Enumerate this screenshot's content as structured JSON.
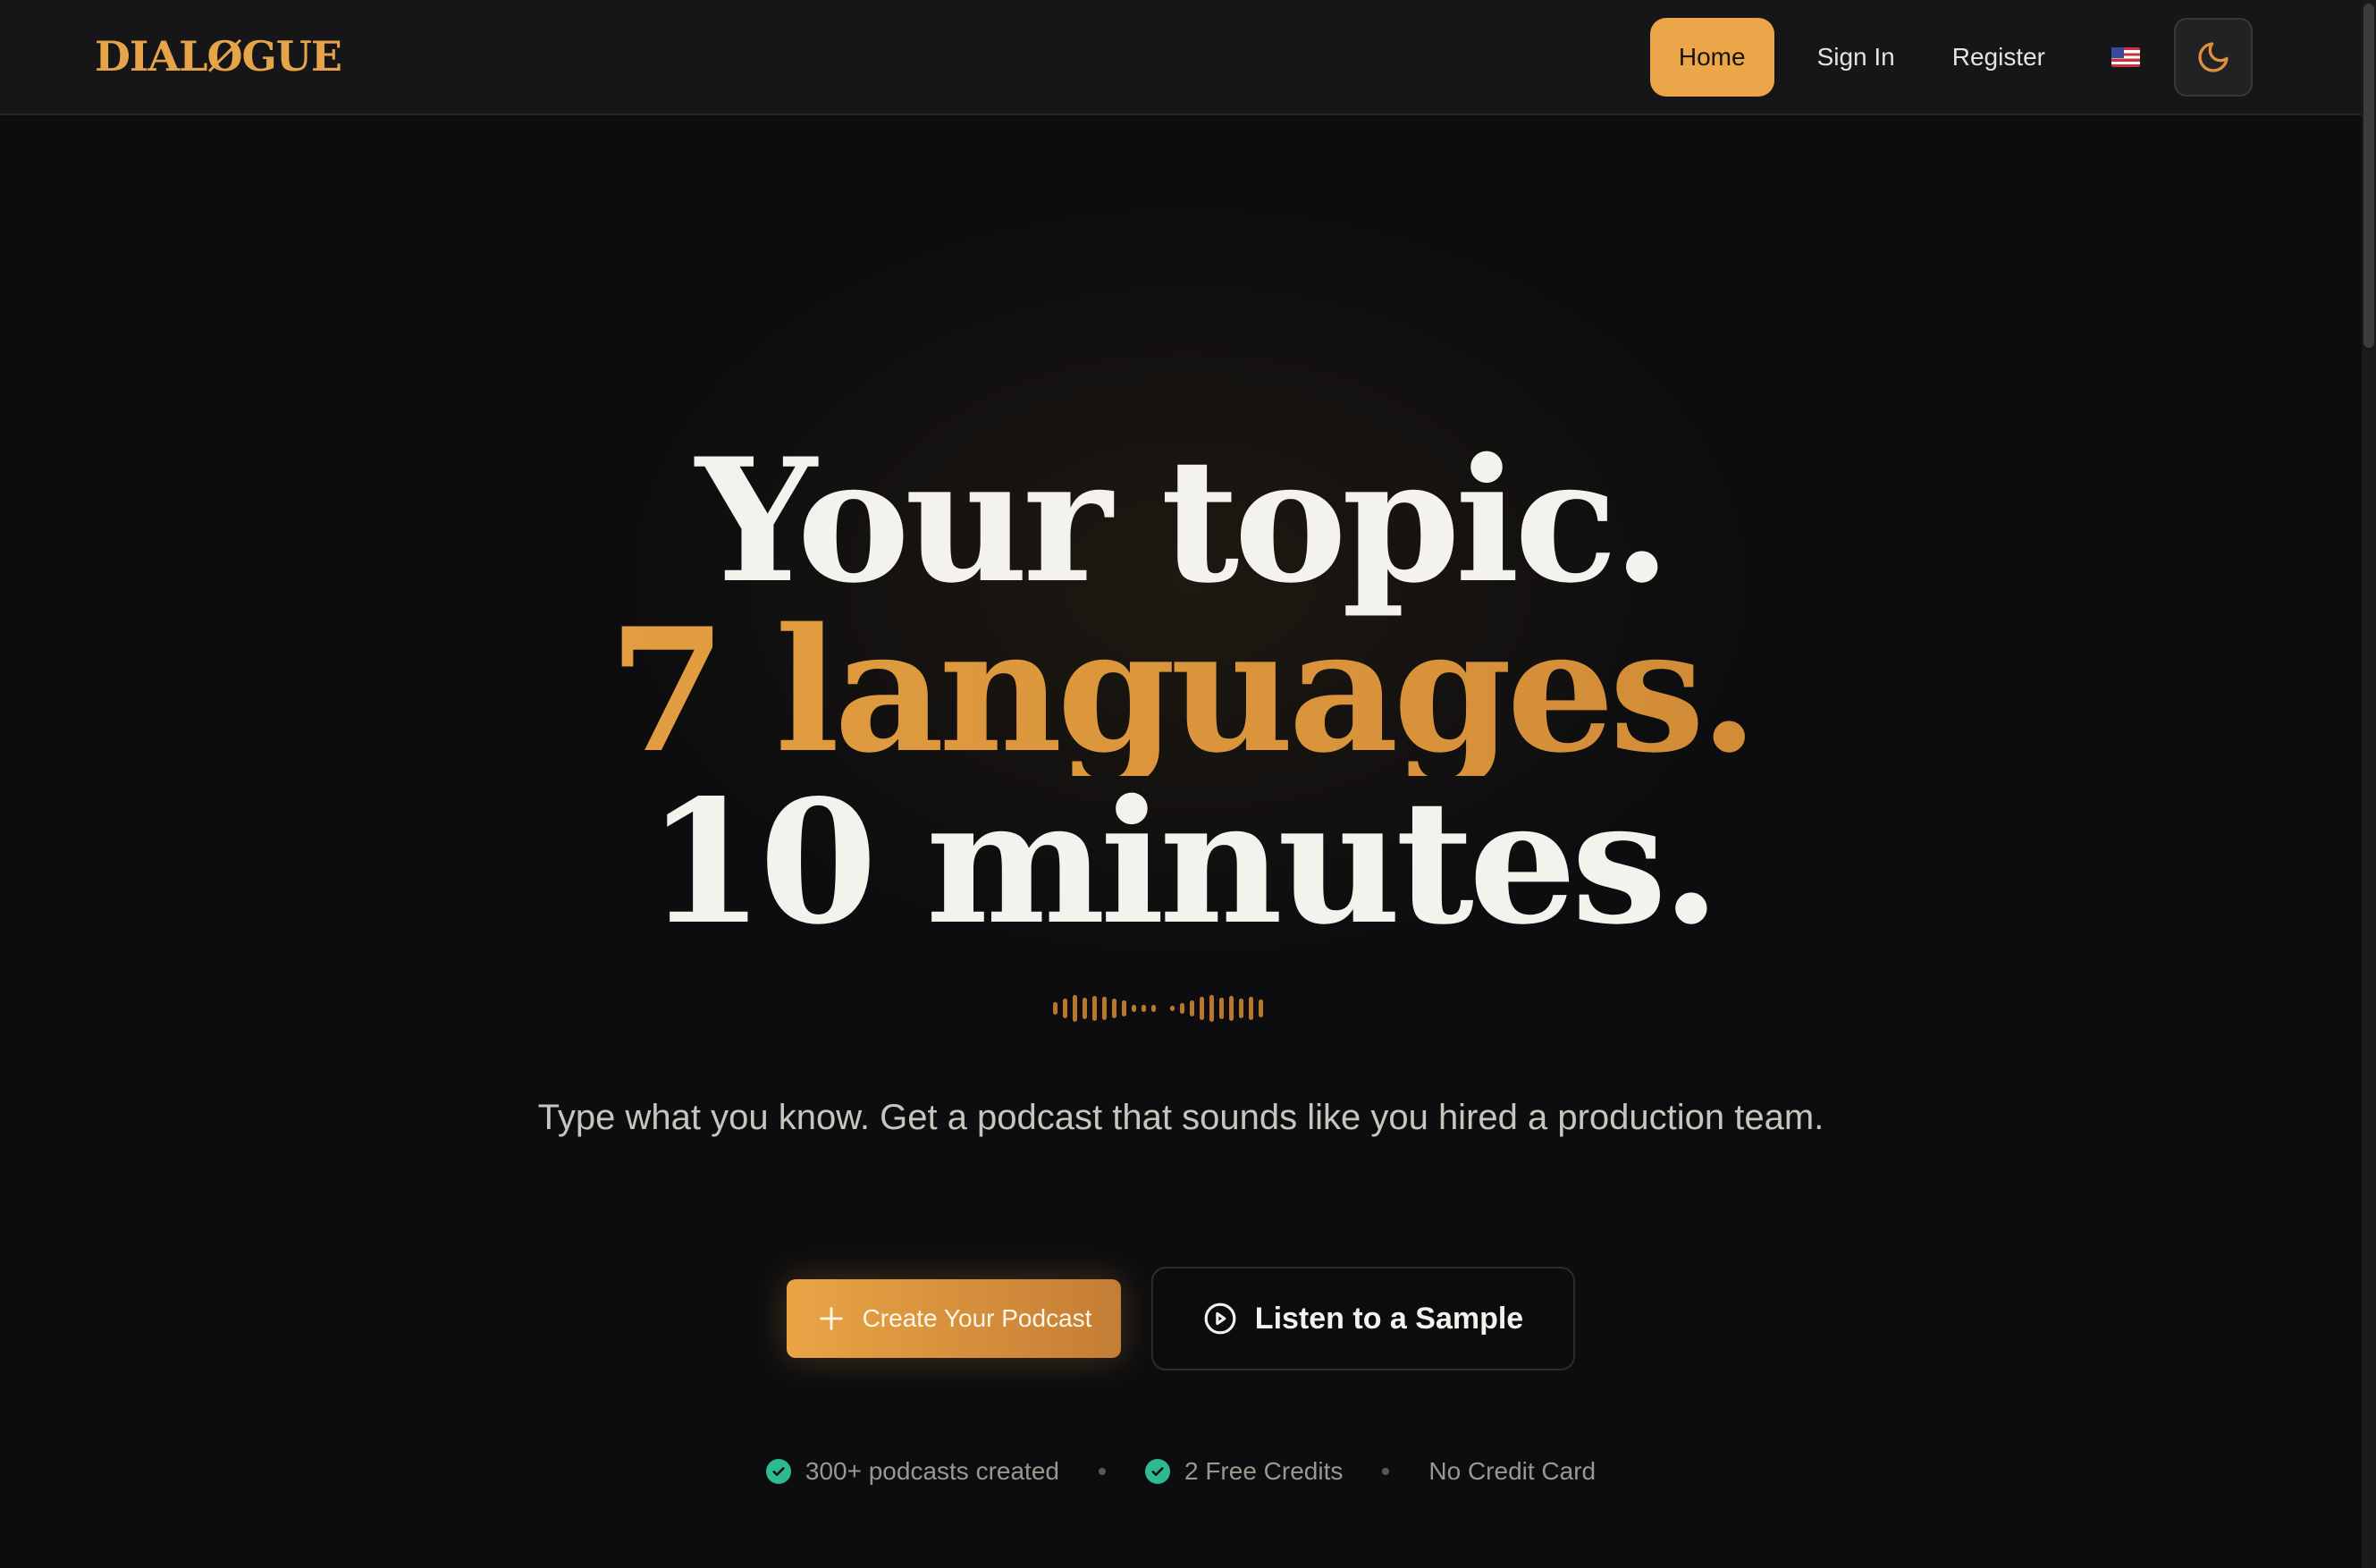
{
  "brand": {
    "logo": "DIALØGUE",
    "accent_color": "#eba64a"
  },
  "nav": {
    "items": [
      {
        "label": "Home",
        "active": true
      },
      {
        "label": "Sign In",
        "active": false
      },
      {
        "label": "Register",
        "active": false
      }
    ],
    "language_icon": "us-flag-icon",
    "theme_icon": "moon-icon"
  },
  "hero": {
    "line1": "Your topic.",
    "line2": "7 languages.",
    "line3": "10 minutes.",
    "subtitle": "Type what you know. Get a podcast that sounds like you hired a production team."
  },
  "actions": {
    "primary_label": "Create Your Podcast",
    "primary_icon": "plus-icon",
    "secondary_label": "Listen to a Sample",
    "secondary_icon": "play-circle-icon"
  },
  "trust": {
    "items": [
      {
        "label": "300+ podcasts created",
        "icon": "check-circle-icon"
      },
      {
        "label": "2 Free Credits",
        "icon": "check-circle-icon"
      },
      {
        "label": "No Credit Card"
      }
    ]
  }
}
